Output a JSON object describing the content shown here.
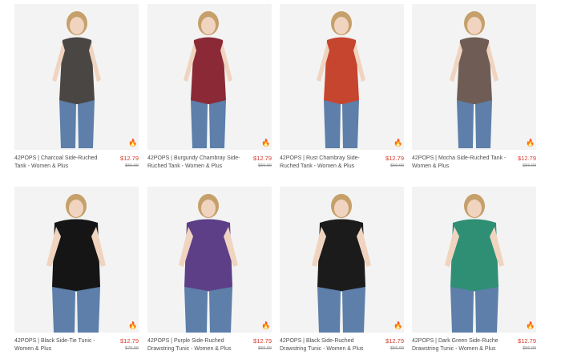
{
  "products": [
    {
      "title": "42POPS | Charcoal Side-Ruched Tank - Women & Plus",
      "price": "$12.79",
      "original_price": "$56.00",
      "color": "#4a4644"
    },
    {
      "title": "42POPS | Burgundy Chambray Side-Ruched Tank - Women & Plus",
      "price": "$12.79",
      "original_price": "$56.00",
      "color": "#8b2a36"
    },
    {
      "title": "42POPS | Rust Chambray Side-Ruched Tank - Women & Plus",
      "price": "$12.79",
      "original_price": "$56.00",
      "color": "#c6452e"
    },
    {
      "title": "42POPS | Mocha Side-Ruched Tank - Women & Plus",
      "price": "$12.79",
      "original_price": "$56.00",
      "color": "#6f5d55"
    },
    {
      "title": "42POPS | Black Side-Tie Tunic - Women & Plus",
      "price": "$12.79",
      "original_price": "$70.00",
      "color": "#151515"
    },
    {
      "title": "42POPS | Purple Side-Ruched Drawstring Tunic - Women & Plus",
      "price": "$12.79",
      "original_price": "$56.00",
      "color": "#5c3f86"
    },
    {
      "title": "42POPS | Black Side-Ruched Drawstring Tunic - Women & Plus",
      "price": "$12.79",
      "original_price": "$56.00",
      "color": "#1b1b1b"
    },
    {
      "title": "42POPS | Dark Green Side-Ruche Drawstring Tunic - Women & Plus",
      "price": "$12.79",
      "original_price": "$56.00",
      "color": "#2f8f74"
    }
  ],
  "ui": {
    "badge_icon": "flame-icon",
    "accent_color": "#d93a2b"
  }
}
